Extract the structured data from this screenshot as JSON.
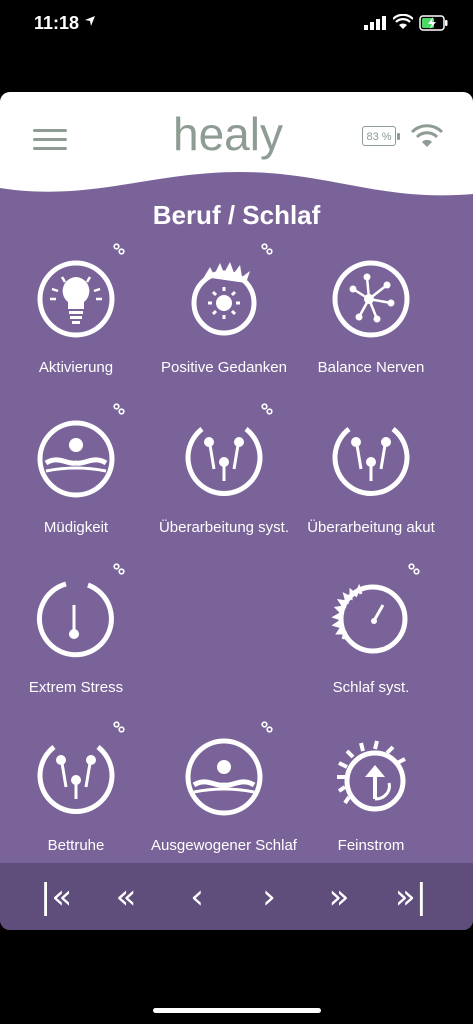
{
  "status_bar": {
    "time": "11:18"
  },
  "header": {
    "battery_text": "83 %",
    "logo_text": "healy"
  },
  "section": {
    "title": "Beruf / Schlaf"
  },
  "programs": [
    {
      "label": "Aktivierung",
      "icon": "lightbulb-icon"
    },
    {
      "label": "Positive Gedanken",
      "icon": "sun-burst-icon"
    },
    {
      "label": "Balance Nerven",
      "icon": "neuron-icon"
    },
    {
      "label": "Müdigkeit",
      "icon": "tired-face-icon"
    },
    {
      "label": "Überarbeitung syst.",
      "icon": "overwork-systemic-icon"
    },
    {
      "label": "Überarbeitung akut",
      "icon": "overwork-acute-icon"
    },
    {
      "label": "Extrem Stress",
      "icon": "extreme-stress-icon"
    },
    {
      "label": "Schlaf syst.",
      "icon": "sleep-systemic-icon"
    },
    {
      "label": "Bettruhe",
      "icon": "bed-rest-icon"
    },
    {
      "label": "Ausgewogener Schlaf",
      "icon": "balanced-sleep-icon"
    },
    {
      "label": "Feinstrom",
      "icon": "fine-current-icon"
    }
  ],
  "nav": {
    "first": "|«",
    "prev_fast": "«",
    "prev": "‹",
    "next": "›",
    "next_fast": "»",
    "last": "»|"
  },
  "colors": {
    "panel": "#7a6399",
    "navbar": "#5f4d7b",
    "header": "#ffffff",
    "logo": "#8e9c94"
  }
}
